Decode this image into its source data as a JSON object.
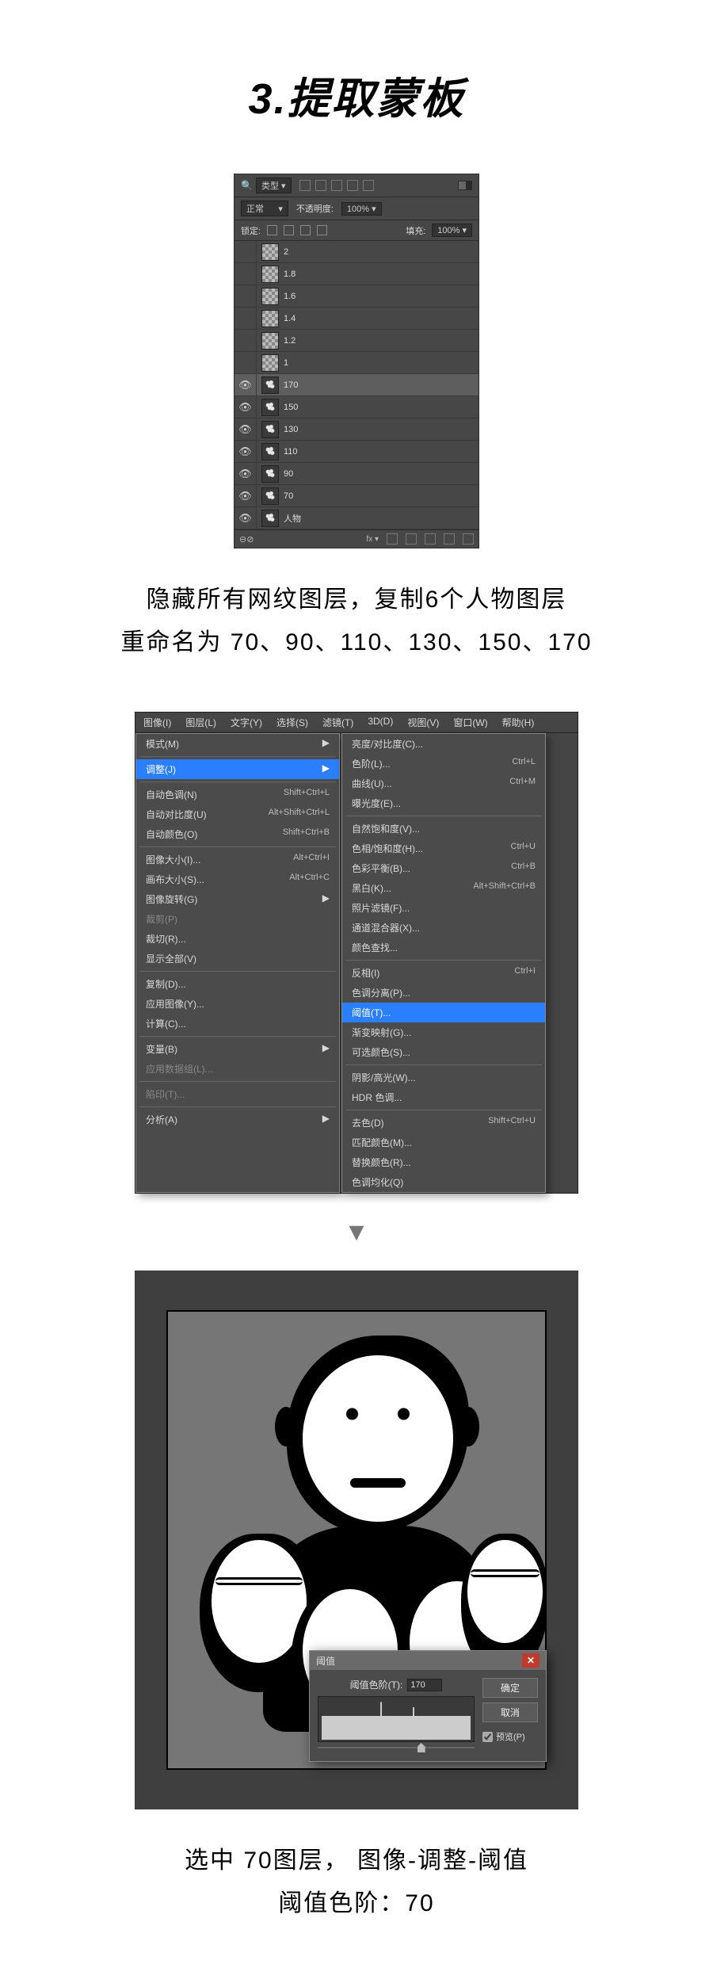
{
  "title": "3.提取蒙板",
  "layers_panel": {
    "kind_label": "类型",
    "search_icon": "🔍",
    "filter_icons": [
      "img",
      "adj",
      "txt",
      "shp",
      "smart"
    ],
    "blend_mode": "正常",
    "opacity_label": "不透明度:",
    "opacity_value": "100%",
    "lock_label": "锁定:",
    "fill_label": "填充:",
    "fill_value": "100%",
    "layers": [
      {
        "visible": false,
        "thumb": "pattern",
        "name": "2"
      },
      {
        "visible": false,
        "thumb": "pattern",
        "name": "1.8"
      },
      {
        "visible": false,
        "thumb": "pattern",
        "name": "1.6"
      },
      {
        "visible": false,
        "thumb": "pattern",
        "name": "1.4"
      },
      {
        "visible": false,
        "thumb": "pattern",
        "name": "1.2"
      },
      {
        "visible": false,
        "thumb": "pattern",
        "name": "1"
      },
      {
        "visible": true,
        "thumb": "people",
        "name": "170",
        "selected": true
      },
      {
        "visible": true,
        "thumb": "people",
        "name": "150"
      },
      {
        "visible": true,
        "thumb": "people",
        "name": "130"
      },
      {
        "visible": true,
        "thumb": "people",
        "name": "110"
      },
      {
        "visible": true,
        "thumb": "people",
        "name": "90"
      },
      {
        "visible": true,
        "thumb": "people",
        "name": "70"
      },
      {
        "visible": true,
        "thumb": "people",
        "name": "人物"
      }
    ],
    "footer_icons": [
      "link",
      "fx",
      "mask",
      "adj",
      "group",
      "new",
      "del"
    ]
  },
  "caption1_line1": "隐藏所有网纹图层，复制6个人物图层",
  "caption1_line2": "重命名为 70、90、110、130、150、170",
  "menubar": [
    "图像(I)",
    "图层(L)",
    "文字(Y)",
    "选择(S)",
    "滤镜(T)",
    "3D(D)",
    "视图(V)",
    "窗口(W)",
    "帮助(H)"
  ],
  "menu_left": [
    {
      "label": "模式(M)",
      "arrow": true
    },
    {
      "sep": true
    },
    {
      "label": "调整(J)",
      "arrow": true,
      "hl": true
    },
    {
      "sep": true
    },
    {
      "label": "自动色调(N)",
      "shortcut": "Shift+Ctrl+L"
    },
    {
      "label": "自动对比度(U)",
      "shortcut": "Alt+Shift+Ctrl+L"
    },
    {
      "label": "自动颜色(O)",
      "shortcut": "Shift+Ctrl+B"
    },
    {
      "sep": true
    },
    {
      "label": "图像大小(I)...",
      "shortcut": "Alt+Ctrl+I"
    },
    {
      "label": "画布大小(S)...",
      "shortcut": "Alt+Ctrl+C"
    },
    {
      "label": "图像旋转(G)",
      "arrow": true
    },
    {
      "label": "裁剪(P)",
      "disabled": true
    },
    {
      "label": "裁切(R)..."
    },
    {
      "label": "显示全部(V)"
    },
    {
      "sep": true
    },
    {
      "label": "复制(D)..."
    },
    {
      "label": "应用图像(Y)..."
    },
    {
      "label": "计算(C)..."
    },
    {
      "sep": true
    },
    {
      "label": "变量(B)",
      "arrow": true
    },
    {
      "label": "应用数据组(L)...",
      "disabled": true
    },
    {
      "sep": true
    },
    {
      "label": "陷印(T)...",
      "disabled": true
    },
    {
      "sep": true
    },
    {
      "label": "分析(A)",
      "arrow": true
    }
  ],
  "menu_right": [
    {
      "label": "亮度/对比度(C)..."
    },
    {
      "label": "色阶(L)...",
      "shortcut": "Ctrl+L"
    },
    {
      "label": "曲线(U)...",
      "shortcut": "Ctrl+M"
    },
    {
      "label": "曝光度(E)..."
    },
    {
      "sep": true
    },
    {
      "label": "自然饱和度(V)..."
    },
    {
      "label": "色相/饱和度(H)...",
      "shortcut": "Ctrl+U"
    },
    {
      "label": "色彩平衡(B)...",
      "shortcut": "Ctrl+B"
    },
    {
      "label": "黑白(K)...",
      "shortcut": "Alt+Shift+Ctrl+B"
    },
    {
      "label": "照片滤镜(F)..."
    },
    {
      "label": "通道混合器(X)..."
    },
    {
      "label": "颜色查找..."
    },
    {
      "sep": true
    },
    {
      "label": "反相(I)",
      "shortcut": "Ctrl+I"
    },
    {
      "label": "色调分离(P)..."
    },
    {
      "label": "阈值(T)...",
      "hl": true
    },
    {
      "label": "渐变映射(G)..."
    },
    {
      "label": "可选颜色(S)..."
    },
    {
      "sep": true
    },
    {
      "label": "阴影/高光(W)..."
    },
    {
      "label": "HDR 色调..."
    },
    {
      "sep": true
    },
    {
      "label": "去色(D)",
      "shortcut": "Shift+Ctrl+U"
    },
    {
      "label": "匹配颜色(M)..."
    },
    {
      "label": "替换颜色(R)..."
    },
    {
      "label": "色调均化(Q)"
    }
  ],
  "down_arrow": "▼",
  "threshold_dialog": {
    "title": "阈值",
    "level_label": "阈值色阶(T):",
    "level_value": "170",
    "slider_pos_pct": 66,
    "btn_ok": "确定",
    "btn_cancel": "取消",
    "preview_label": "预览(P)"
  },
  "caption2_line1": "选中 70图层， 图像-调整-阈值",
  "caption2_line2": "阈值色阶：70"
}
